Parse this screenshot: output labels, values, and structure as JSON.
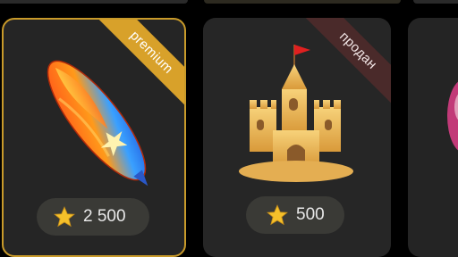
{
  "cards": [
    {
      "ribbon": "premium",
      "price": "2 500",
      "item": "surfboard",
      "ribbon_color": "#d8a12a",
      "selected": true
    },
    {
      "ribbon": "продан",
      "price": "500",
      "item": "sand-castle",
      "ribbon_color": "#4a2a2a",
      "selected": false
    }
  ],
  "icons": {
    "currency": "star-icon"
  },
  "colors": {
    "selected_border": "#c89a2a",
    "card_bg": "#262626",
    "price_pill": "#3a3a36"
  }
}
